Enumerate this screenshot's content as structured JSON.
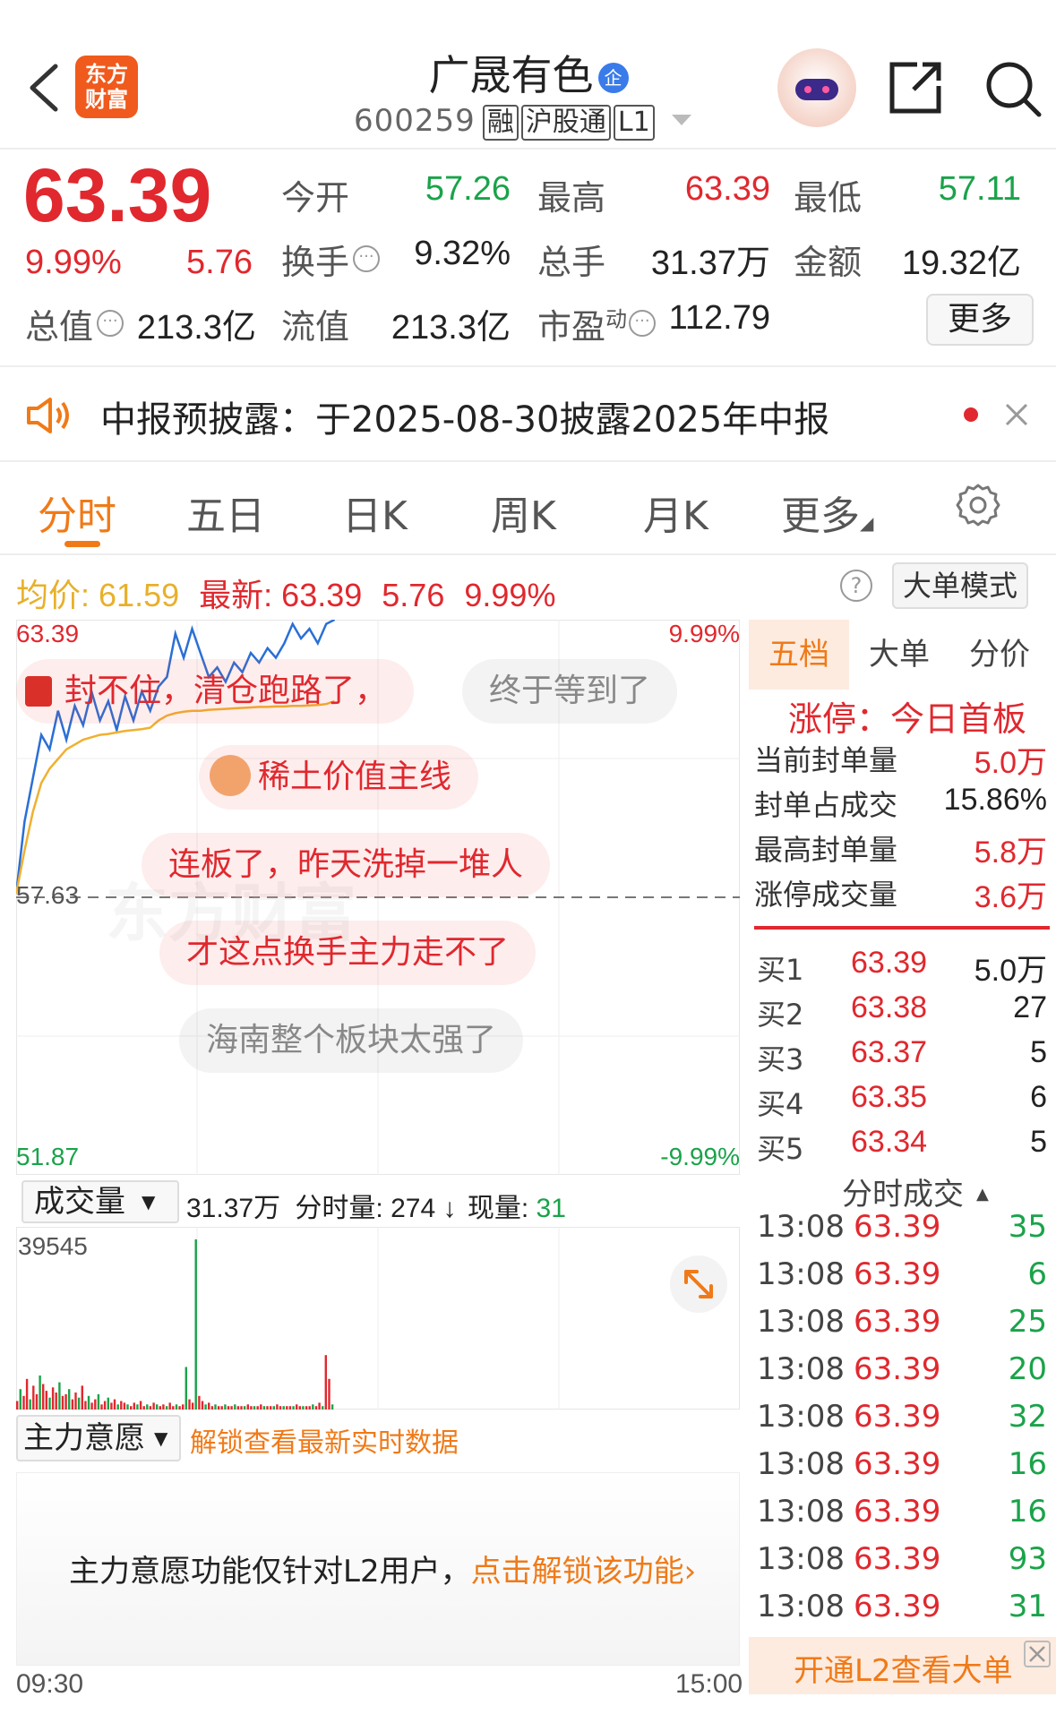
{
  "header": {
    "logo_line1": "东方",
    "logo_line2": "财富",
    "stock_name": "广晟有色",
    "verified_badge": "企",
    "stock_code": "600259",
    "tags": [
      "融",
      "沪股通",
      "L1"
    ]
  },
  "quote": {
    "price": "63.39",
    "change_pct": "9.99%",
    "change": "5.76",
    "stats": [
      {
        "label": "今开",
        "value": "57.26",
        "color": "#1aa34a"
      },
      {
        "label": "最高",
        "value": "63.39",
        "color": "#e0282e"
      },
      {
        "label": "最低",
        "value": "57.11",
        "color": "#1aa34a"
      },
      {
        "label": "换手",
        "value": "9.32%",
        "color": "#222222"
      },
      {
        "label": "总手",
        "value": "31.37万",
        "color": "#222222"
      },
      {
        "label": "金额",
        "value": "19.32亿",
        "color": "#222222"
      },
      {
        "label": "总值",
        "value": "213.3亿",
        "color": "#222222"
      },
      {
        "label": "流值",
        "value": "213.3亿",
        "color": "#222222"
      },
      {
        "label": "市盈",
        "sup": "动",
        "value": "112.79",
        "color": "#222222"
      }
    ],
    "more_button": "更多"
  },
  "notice": {
    "text": "中报预披露：于2025-08-30披露2025年中报"
  },
  "tabs": [
    "分时",
    "五日",
    "日K",
    "周K",
    "月K",
    "更多"
  ],
  "active_tab": "分时",
  "chart_header": {
    "avg_label": "均价:",
    "avg_value": "61.59",
    "latest_label": "最新:",
    "latest_price": "63.39",
    "latest_change": "5.76",
    "latest_pct": "9.99%",
    "mode_button": "大单模式"
  },
  "chart_data": {
    "type": "line",
    "y_top": "63.39",
    "y_mid": "57.63",
    "y_bottom": "51.87",
    "pct_top": "9.99%",
    "pct_bottom": "-9.99%",
    "ylim": [
      51.87,
      63.39
    ],
    "x_start": "09:30",
    "x_end": "15:00",
    "series": [
      {
        "values": [
          57.7,
          59.2,
          60.1,
          61.0,
          60.7,
          61.5,
          60.9,
          61.6,
          61.2,
          61.9,
          61.3,
          61.7,
          61.1,
          61.8,
          61.3,
          61.9,
          61.5,
          62.0,
          62.2,
          63.1,
          62.6,
          63.2,
          62.7,
          62.2,
          62.4,
          62.1,
          62.5,
          62.3,
          62.7,
          62.5,
          62.8,
          62.6,
          62.9,
          63.3,
          63.0,
          63.2,
          62.9,
          63.3,
          63.39
        ]
      },
      {
        "values": [
          57.7,
          58.6,
          59.4,
          60.0,
          60.3,
          60.5,
          60.7,
          60.8,
          60.9,
          60.95,
          61.0,
          61.02,
          61.05,
          61.08,
          61.1,
          61.12,
          61.15,
          61.3,
          61.4,
          61.45,
          61.48,
          61.5,
          61.5,
          61.52,
          61.53,
          61.54,
          61.55,
          61.56,
          61.57,
          61.58,
          61.58,
          61.59,
          61.59,
          61.6,
          61.6,
          61.61,
          61.62,
          61.64,
          61.7
        ]
      }
    ],
    "volume_bars": [
      5,
      12,
      8,
      18,
      6,
      14,
      9,
      20,
      15,
      11,
      7,
      13,
      10,
      16,
      8,
      9,
      12,
      6,
      10,
      7,
      14,
      5,
      8,
      4,
      6,
      9,
      3,
      5,
      7,
      4,
      6,
      3,
      5,
      4,
      3,
      2,
      4,
      3,
      5,
      2,
      3,
      2,
      4,
      3,
      2,
      3,
      2,
      4,
      2,
      3,
      2,
      3,
      25,
      6,
      4,
      100,
      8,
      5,
      3,
      4,
      2,
      3,
      2,
      2,
      3,
      2,
      2,
      3,
      2,
      2,
      2,
      3,
      2,
      2,
      2,
      3,
      2,
      2,
      2,
      2,
      3,
      2,
      2,
      2,
      2,
      2,
      3,
      2,
      2,
      2,
      2,
      3,
      2,
      4,
      2,
      32,
      18,
      3
    ]
  },
  "comments": [
    {
      "text": "封不住，清仓跑路了，",
      "style": "red",
      "icon": true
    },
    {
      "text": "终于等到了",
      "style": "gray"
    },
    {
      "text": "稀土价值主线",
      "style": "red",
      "icon": true
    },
    {
      "text": "连板了，昨天洗掉一堆人",
      "style": "red"
    },
    {
      "text": "才这点换手主力走不了",
      "style": "red"
    },
    {
      "text": "海南整个板块太强了",
      "style": "gray"
    }
  ],
  "volume": {
    "selector": "成交量",
    "total": "31.37万",
    "minute_label": "分时量:",
    "minute_value": "274",
    "current_label": "现量:",
    "current_value": "31",
    "max_label": "39545"
  },
  "main_force": {
    "selector": "主力意愿",
    "unlock_link": "解锁查看最新实时数据",
    "notice_text": "主力意愿功能仅针对L2用户，",
    "notice_link": "点击解锁该功能›"
  },
  "side": {
    "tabs": [
      "五档",
      "大单",
      "分价"
    ],
    "limit_title": "涨停：今日首板",
    "limit_stats": [
      {
        "label": "当前封单量",
        "value": "5.0万"
      },
      {
        "label": "封单占成交",
        "value": "15.86%"
      },
      {
        "label": "最高封单量",
        "value": "5.8万"
      },
      {
        "label": "涨停成交量",
        "value": "3.6万"
      }
    ],
    "bids": [
      {
        "label": "买1",
        "price": "63.39",
        "vol": "5.0万"
      },
      {
        "label": "买2",
        "price": "63.38",
        "vol": "27"
      },
      {
        "label": "买3",
        "price": "63.37",
        "vol": "5"
      },
      {
        "label": "买4",
        "price": "63.35",
        "vol": "6"
      },
      {
        "label": "买5",
        "price": "63.34",
        "vol": "5"
      }
    ],
    "trades_title": "分时成交",
    "trades": [
      {
        "time": "13:08",
        "price": "63.39",
        "vol": "35"
      },
      {
        "time": "13:08",
        "price": "63.39",
        "vol": "6"
      },
      {
        "time": "13:08",
        "price": "63.39",
        "vol": "25"
      },
      {
        "time": "13:08",
        "price": "63.39",
        "vol": "20"
      },
      {
        "time": "13:08",
        "price": "63.39",
        "vol": "32"
      },
      {
        "time": "13:08",
        "price": "63.39",
        "vol": "16"
      },
      {
        "time": "13:08",
        "price": "63.39",
        "vol": "16"
      },
      {
        "time": "13:08",
        "price": "63.39",
        "vol": "93"
      },
      {
        "time": "13:08",
        "price": "63.39",
        "vol": "31"
      }
    ],
    "l2_banner": "开通L2查看大单"
  }
}
